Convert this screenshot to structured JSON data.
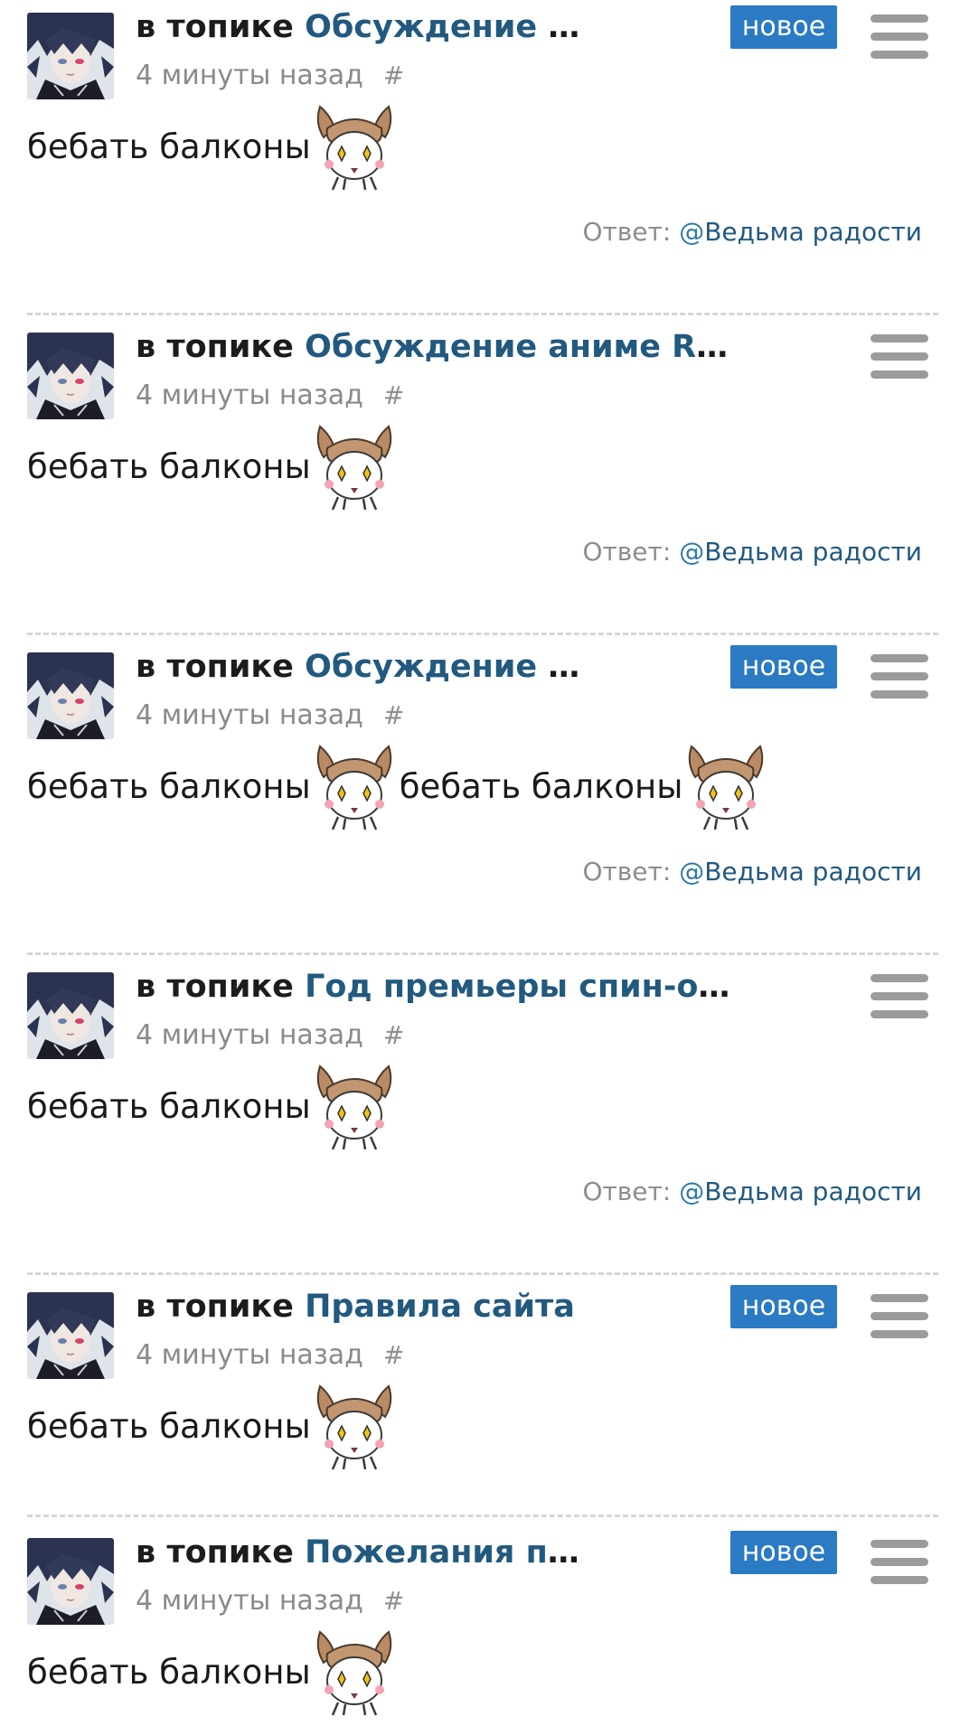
{
  "comments": [
    {
      "prefix": "в топике",
      "topic": "Обсуждение ани...",
      "time": "4 минуты назад",
      "hash": "#",
      "badge": "новое",
      "text1": "бебать балконы",
      "text2": "",
      "reply_label": "Ответ:",
      "reply_at": "@",
      "reply_to": "Ведьма радости"
    },
    {
      "prefix": "в топике",
      "topic": "Обсуждение аниме Rurouni Ken...",
      "time": "4 минуты назад",
      "hash": "#",
      "badge": "",
      "text1": "бебать балконы",
      "text2": "",
      "reply_label": "Ответ:",
      "reply_at": "@",
      "reply_to": "Ведьма радости"
    },
    {
      "prefix": "в топике",
      "topic": "Обсуждение ани...",
      "time": "4 минуты назад",
      "hash": "#",
      "badge": "новое",
      "text1": "бебать балконы",
      "text2": "бебать балконы",
      "reply_label": "Ответ:",
      "reply_at": "@",
      "reply_to": "Ведьма радости"
    },
    {
      "prefix": "в топике",
      "topic": "Год премьеры спин-офф аниме ...",
      "time": "4 минуты назад",
      "hash": "#",
      "badge": "",
      "text1": "бебать балконы",
      "text2": "",
      "reply_label": "Ответ:",
      "reply_at": "@",
      "reply_to": "Ведьма радости"
    },
    {
      "prefix": "в топике",
      "topic": "Правила сайта",
      "time": "4 минуты назад",
      "hash": "#",
      "badge": "новое",
      "text1": "бебать балконы",
      "text2": ""
    },
    {
      "prefix": "в топике",
      "topic": "Пожелания по с...",
      "time": "4 минуты назад",
      "hash": "#",
      "badge": "новое",
      "text1": "бебать балконы",
      "text2": ""
    }
  ],
  "icons": {
    "menu": "hamburger-menu-icon",
    "emoji": "deer-smiley-icon",
    "avatar": "anime-avatar"
  },
  "colors": {
    "topic_link": "#22597f",
    "badge_bg": "#2a7ac4",
    "meta_text": "#8a8a8a",
    "reply_link": "#2b79a6",
    "menu_icon": "#9b9b9b",
    "separator": "#d6d6d6"
  }
}
